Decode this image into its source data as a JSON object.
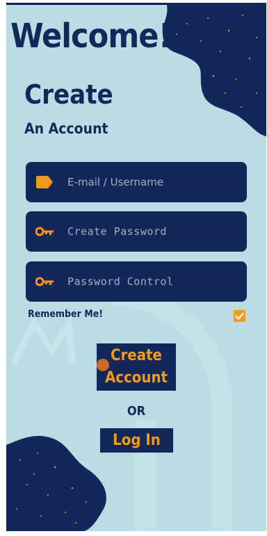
{
  "header": {
    "welcome": "Welcome!",
    "title": "Create",
    "subtitle": "An Account"
  },
  "form": {
    "email_placeholder": "E-mail / Username",
    "email_icon": "tag-icon",
    "password_placeholder": "Create Password",
    "password_icon": "key-icon",
    "confirm_placeholder": "Password Control",
    "confirm_icon": "key-icon",
    "remember_label": "Remember Me!",
    "remember_checked": true
  },
  "actions": {
    "create_line1": "Create",
    "create_line2": "Account",
    "or_label": "OR",
    "login_label": "Log In"
  },
  "colors": {
    "background": "#bbdce3",
    "navy": "#13285a",
    "accent": "#f39a1e"
  }
}
